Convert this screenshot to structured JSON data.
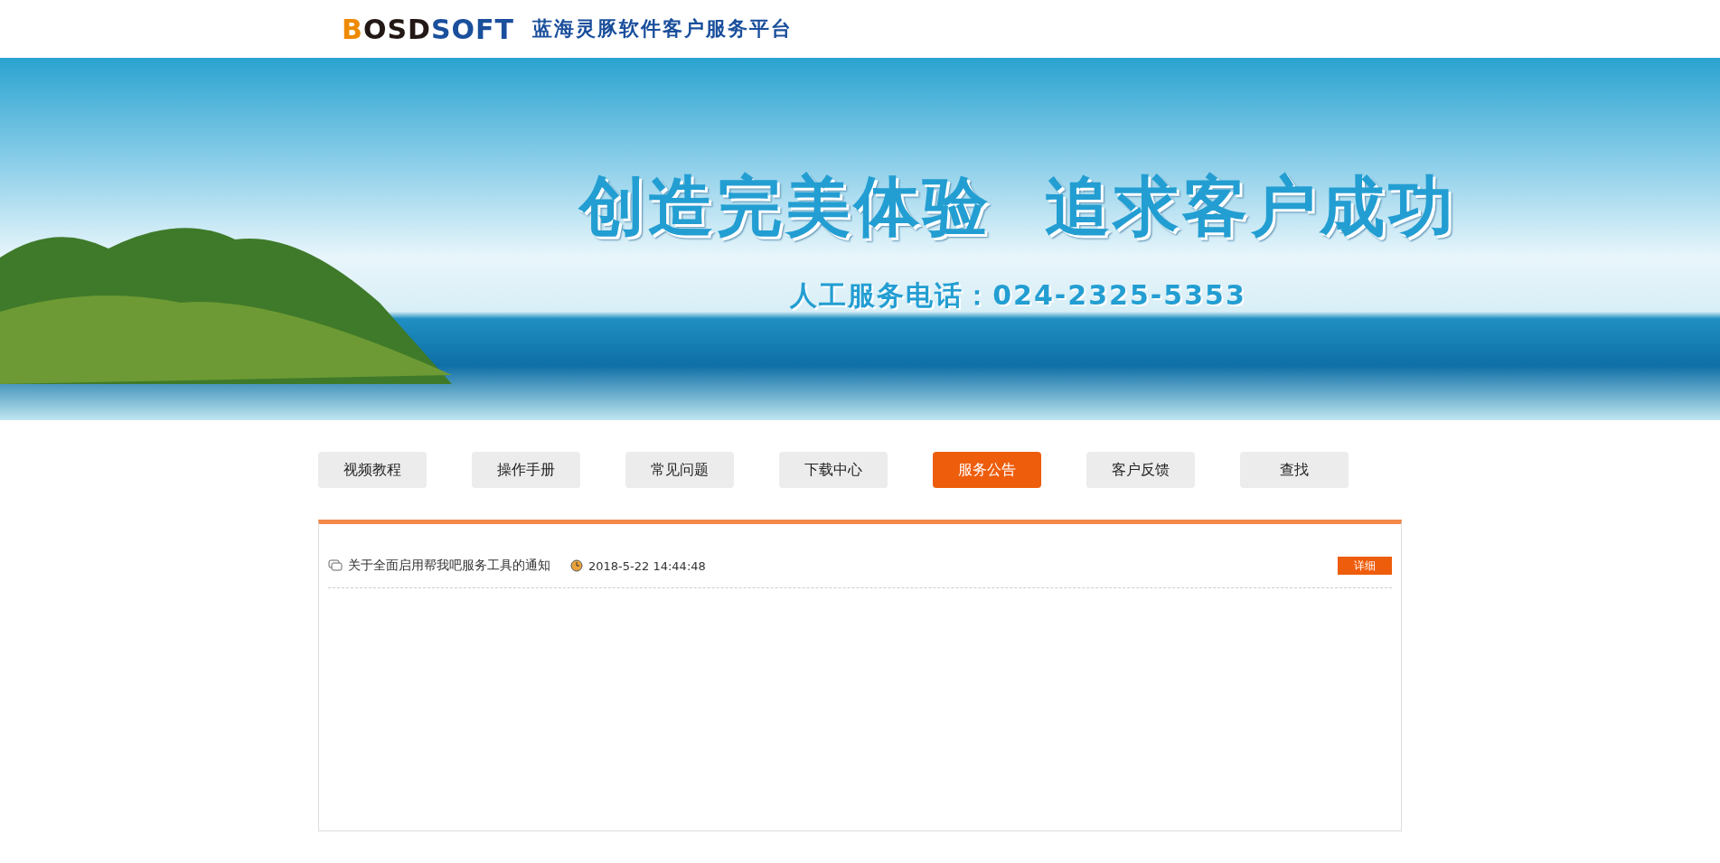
{
  "header": {
    "logo": [
      {
        "text": "B",
        "kind": "accent"
      },
      {
        "text": "OSD",
        "kind": "dark"
      },
      {
        "text": "SOFT",
        "kind": "brand"
      }
    ],
    "title": "蓝海灵豚软件客户服务平台"
  },
  "banner": {
    "headline": "创造完美体验  追求客户成功",
    "phone": "人工服务电话：024-2325-5353"
  },
  "nav": [
    {
      "label": "视频教程",
      "selected": false
    },
    {
      "label": "操作手册",
      "selected": false
    },
    {
      "label": "常见问题",
      "selected": false
    },
    {
      "label": "下载中心",
      "selected": false
    },
    {
      "label": "服务公告",
      "selected": true
    },
    {
      "label": "客户反馈",
      "selected": false
    },
    {
      "label": "查找",
      "selected": false
    }
  ],
  "notices": [
    {
      "title": "关于全面启用帮我吧服务工具的通知",
      "date": "2018-5-22 14:44:48",
      "action": "详细"
    }
  ]
}
